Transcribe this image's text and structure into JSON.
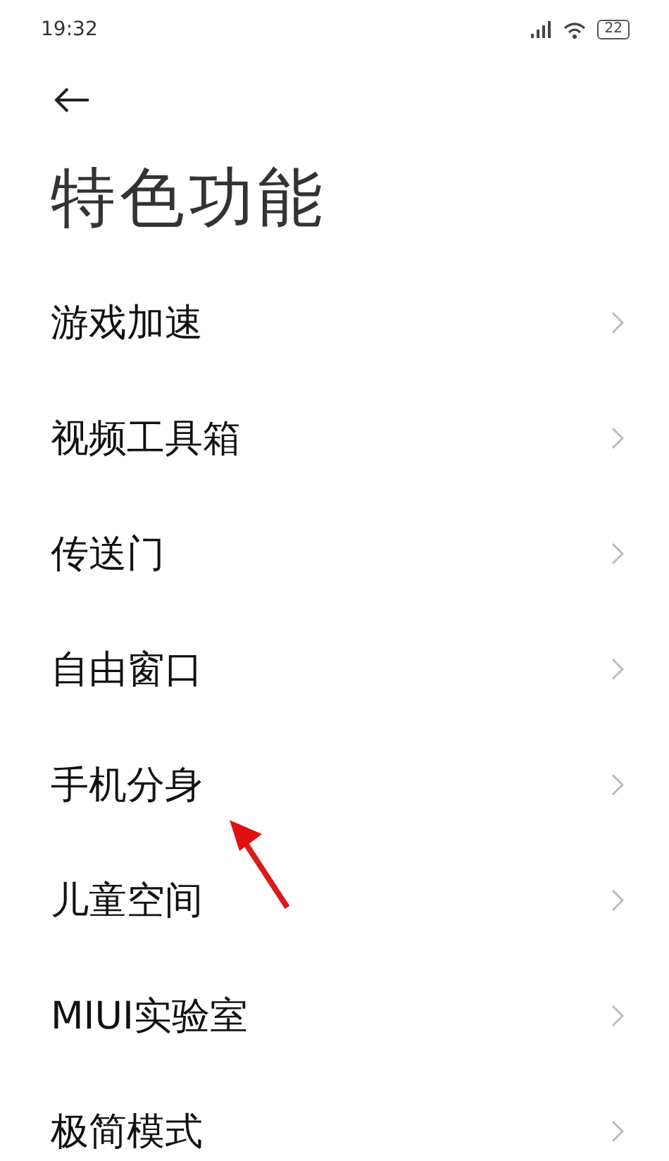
{
  "status_bar": {
    "time": "19:32",
    "battery": "22"
  },
  "title": "特色功能",
  "items": [
    {
      "label": "游戏加速"
    },
    {
      "label": "视频工具箱"
    },
    {
      "label": "传送门"
    },
    {
      "label": "自由窗口"
    },
    {
      "label": "手机分身"
    },
    {
      "label": "儿童空间"
    },
    {
      "label": "MIUI实验室"
    },
    {
      "label": "极简模式"
    }
  ]
}
